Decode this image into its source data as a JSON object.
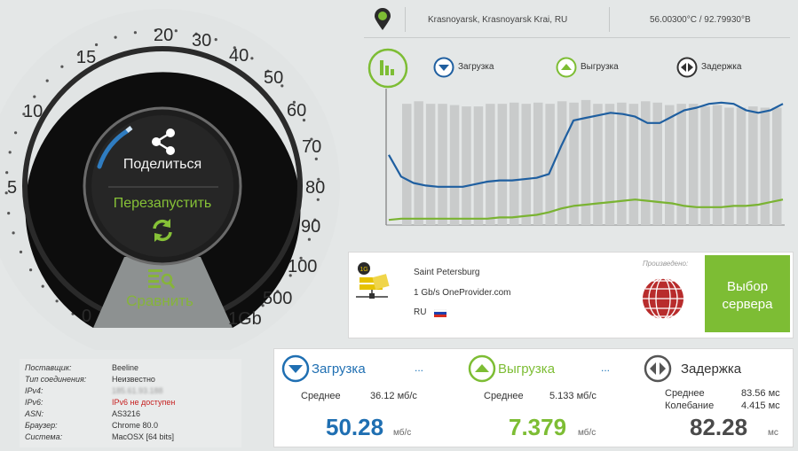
{
  "gauge": {
    "scale_labels": [
      "0",
      "5",
      "10",
      "15",
      "20",
      "30",
      "40",
      "50",
      "60",
      "70",
      "80",
      "90",
      "100",
      "500",
      "1Gb"
    ],
    "share_label": "Поделиться",
    "restart_label": "Перезапустить",
    "compare_label": "Сравнить",
    "accent": "#86c137",
    "progress_color": "#2f7cc0"
  },
  "provider_info": {
    "rows": [
      {
        "key": "Поставщик:",
        "value": "Beeline"
      },
      {
        "key": "Тип соединения:",
        "value": "Неизвестно"
      },
      {
        "key": "IPv4:",
        "value": "185.61.93.188"
      },
      {
        "key": "IPv6:",
        "value": "IPv6 не доступен"
      },
      {
        "key": "ASN:",
        "value": "AS3216"
      },
      {
        "key": "Браузер:",
        "value": "Chrome 80.0"
      },
      {
        "key": "Система:",
        "value": "MacOSX [64 bits]"
      }
    ]
  },
  "location": {
    "city": "Krasnoyarsk, Krasnoyarsk Krai, RU",
    "coords": "56.00300°C / 92.79930°B"
  },
  "legend": {
    "download": "Загрузка",
    "upload": "Выгрузка",
    "latency": "Задержка"
  },
  "chart_data": {
    "type": "line",
    "series": [
      {
        "name": "Загрузка",
        "color": "#1f5fa0",
        "values": [
          0.55,
          0.38,
          0.33,
          0.31,
          0.3,
          0.3,
          0.3,
          0.32,
          0.34,
          0.35,
          0.35,
          0.36,
          0.37,
          0.4,
          0.62,
          0.82,
          0.84,
          0.86,
          0.88,
          0.87,
          0.85,
          0.8,
          0.8,
          0.85,
          0.9,
          0.92,
          0.95,
          0.96,
          0.95,
          0.9,
          0.88,
          0.9,
          0.95
        ]
      },
      {
        "name": "Выгрузка",
        "color": "#7ab332",
        "values": [
          0.04,
          0.05,
          0.05,
          0.05,
          0.05,
          0.05,
          0.05,
          0.05,
          0.05,
          0.06,
          0.06,
          0.07,
          0.08,
          0.1,
          0.13,
          0.15,
          0.16,
          0.17,
          0.18,
          0.19,
          0.2,
          0.19,
          0.18,
          0.17,
          0.15,
          0.14,
          0.14,
          0.14,
          0.15,
          0.15,
          0.16,
          0.18,
          0.2
        ]
      }
    ],
    "bars": [
      0.0,
      0.95,
      0.97,
      0.95,
      0.95,
      0.94,
      0.93,
      0.93,
      0.95,
      0.95,
      0.96,
      0.95,
      0.96,
      0.95,
      0.97,
      0.96,
      0.98,
      0.95,
      0.95,
      0.96,
      0.95,
      0.97,
      0.96,
      0.94,
      0.95,
      0.95,
      0.93,
      0.94,
      0.92,
      0.92,
      0.93,
      0.92,
      0.92
    ]
  },
  "server": {
    "city": "Saint Petersburg",
    "provider": "1 Gb/s OneProvider.com",
    "country": "RU",
    "produced_label": "Произведено:",
    "choose_line1": "Выбор",
    "choose_line2": "сервера"
  },
  "results": {
    "download": {
      "title": "Загрузка",
      "avg_label": "Среднее",
      "avg_value": "36.12 мб/с",
      "value": "50.28",
      "unit": "мб/с",
      "color": "#1f6fb2",
      "dots": "..."
    },
    "upload": {
      "title": "Выгрузка",
      "avg_label": "Среднее",
      "avg_value": "5.133 мб/с",
      "value": "7.379",
      "unit": "мб/с",
      "color": "#7dbd34",
      "dots": "..."
    },
    "latency": {
      "title": "Задержка",
      "avg_label": "Среднее",
      "avg_value": "83.56 мс",
      "jitter_label": "Колебание",
      "jitter_value": "4.415 мс",
      "value": "82.28",
      "unit": "мс",
      "color": "#4a4a4a",
      "dots": "..."
    }
  }
}
